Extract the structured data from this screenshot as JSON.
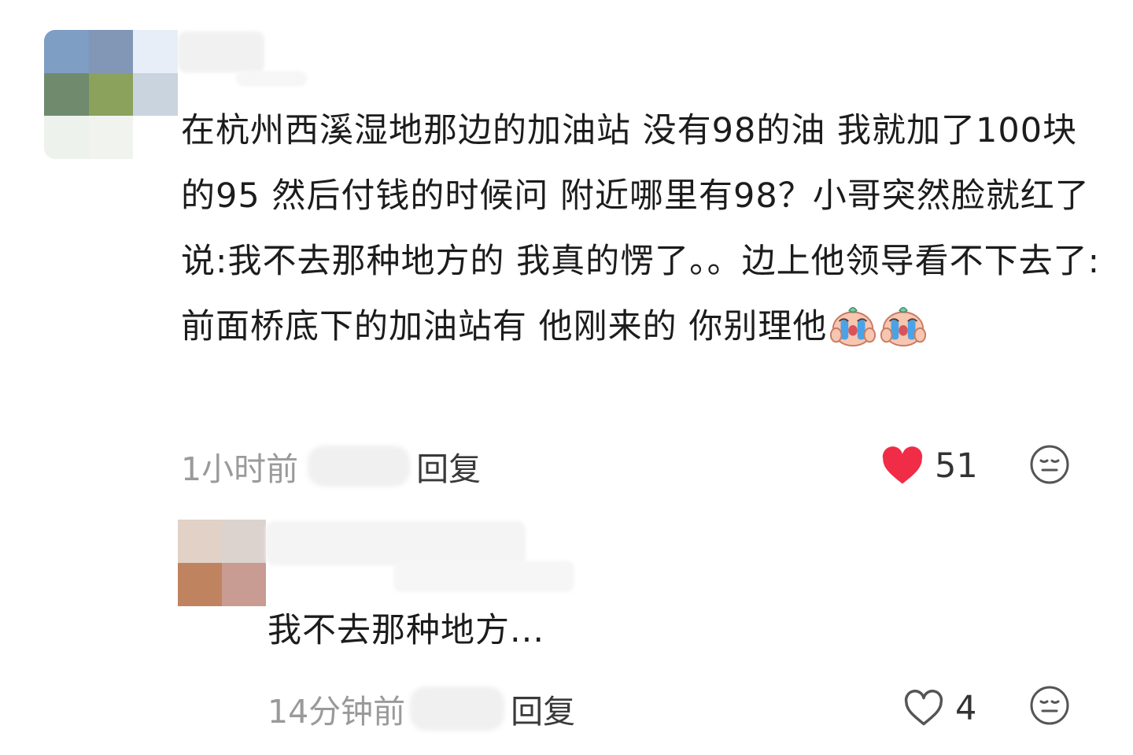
{
  "comments": [
    {
      "text": "在杭州西溪湿地那边的加油站 没有98的油 我就加了100块的95 然后付钱的时候问 附近哪里有98？小哥突然脸就红了 说:我不去那种地方的 我真的愣了。。边上他领导看不下去了:前面桥底下的加油站有 他刚来的 你别理他",
      "emoji": "crying-face-emoji",
      "time": "1小时前",
      "reply_label": "回复",
      "like_count": "51",
      "liked": true,
      "like_color": "#f02c47"
    },
    {
      "text": "我不去那种地方...",
      "time": "14分钟前",
      "reply_label": "回复",
      "like_count": "4",
      "liked": false
    }
  ],
  "icons": {
    "liked_heart": "heart-filled-icon",
    "unliked_heart": "heart-outline-icon",
    "dislike": "meh-face-icon"
  },
  "colors": {
    "text": "#1c1c1c",
    "meta": "#9a9a9a",
    "reply": "#3a3a3a",
    "heart_active": "#f02c47",
    "icon_gray": "#555555"
  }
}
